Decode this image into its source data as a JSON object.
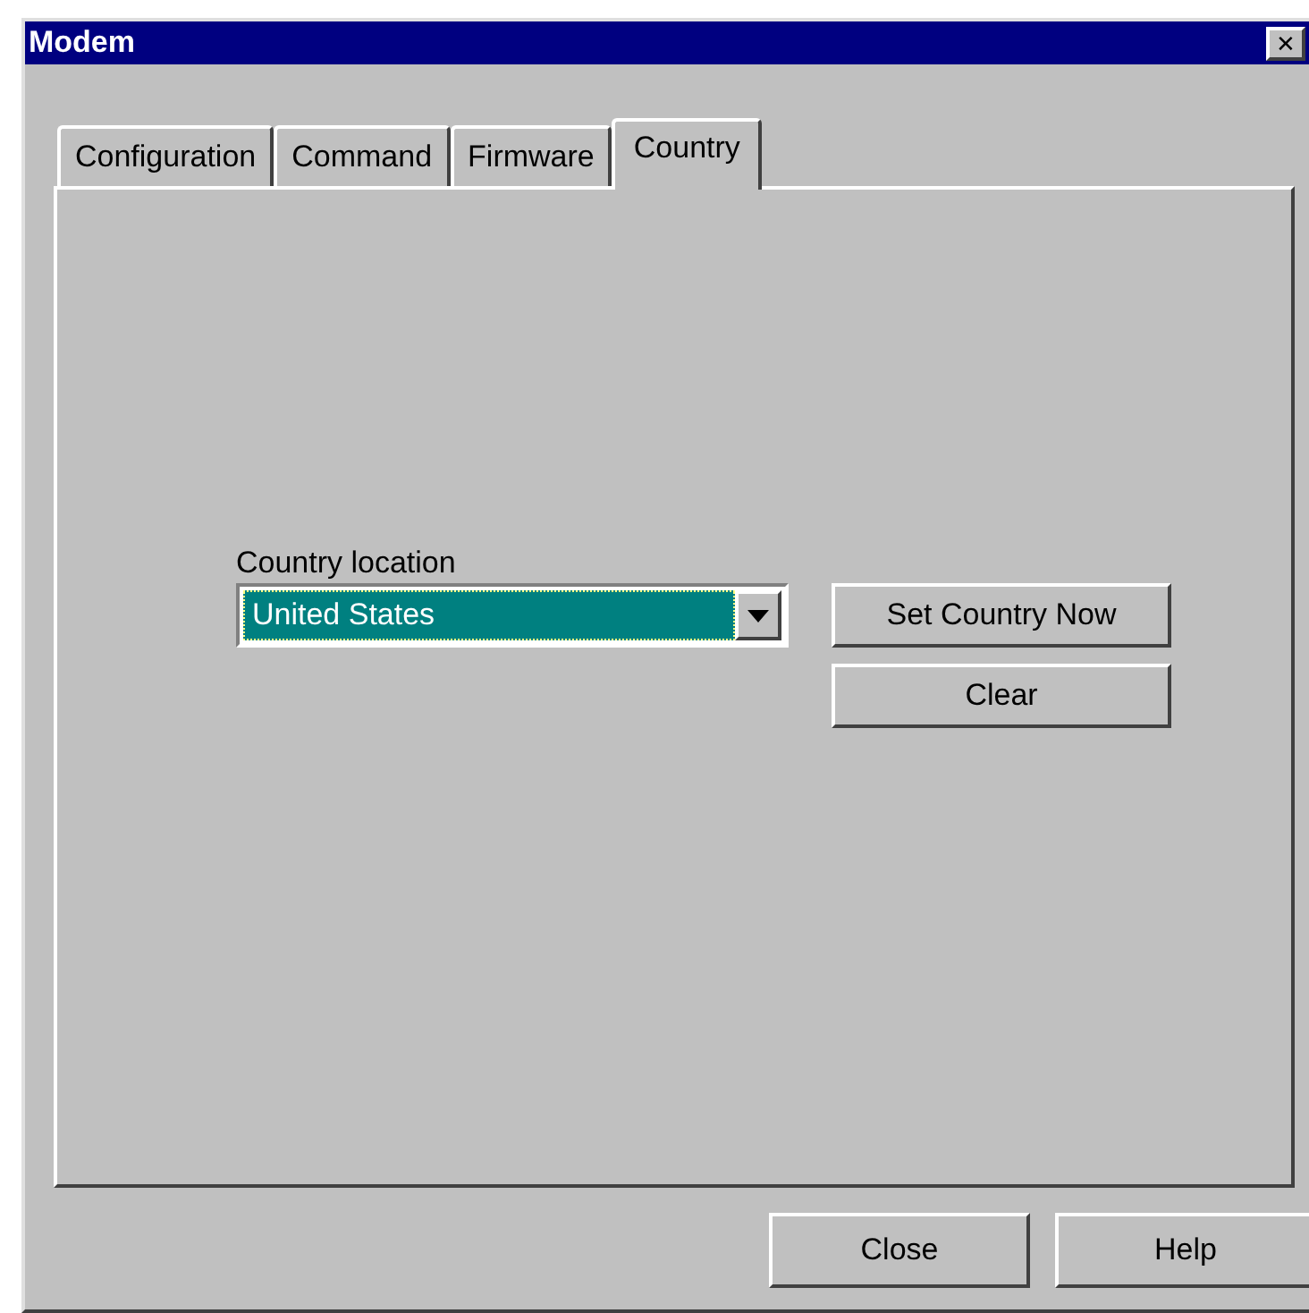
{
  "window": {
    "title": "Modem",
    "close": "✕"
  },
  "tabs": [
    {
      "label": "Configuration",
      "selected": false
    },
    {
      "label": "Command",
      "selected": false
    },
    {
      "label": "Firmware",
      "selected": false
    },
    {
      "label": "Country",
      "selected": true
    }
  ],
  "country": {
    "label": "Country location",
    "value": "United States",
    "buttons": [
      "Set Country Now",
      "Clear"
    ]
  },
  "buttons": [
    "Close",
    "Help"
  ]
}
